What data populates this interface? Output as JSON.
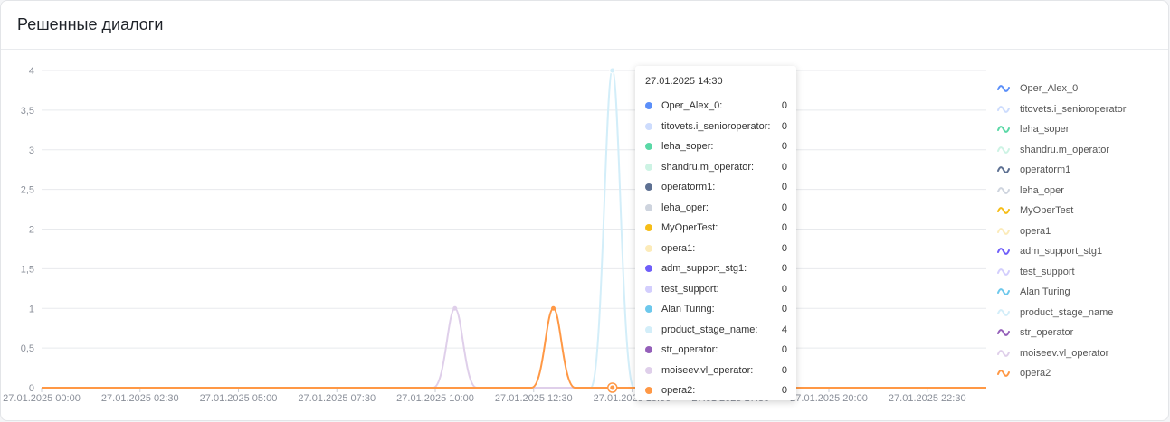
{
  "card": {
    "title": "Решенные диалоги"
  },
  "chart_data": {
    "type": "line",
    "title": "",
    "xlabel": "",
    "ylabel": "",
    "ylim": [
      0,
      4
    ],
    "y_ticks": [
      "0",
      "0,5",
      "1",
      "1,5",
      "2",
      "2,5",
      "3",
      "3,5",
      "4"
    ],
    "x_ticks": [
      "27.01.2025 00:00",
      "27.01.2025 02:30",
      "27.01.2025 05:00",
      "27.01.2025 07:30",
      "27.01.2025 10:00",
      "27.01.2025 12:30",
      "27.01.2025 15:00",
      "27.01.2025 17:30",
      "27.01.2025 20:00",
      "27.01.2025 22:30"
    ],
    "x_range_hours": [
      0,
      24
    ],
    "grid": true,
    "legend_position": "right",
    "series": [
      {
        "name": "Oper_Alex_0",
        "color": "#5b8ff9",
        "points": []
      },
      {
        "name": "titovets.i_senioroperator",
        "color": "#cddcfd",
        "points": []
      },
      {
        "name": "leha_soper",
        "color": "#5ad8a6",
        "points": []
      },
      {
        "name": "shandru.m_operator",
        "color": "#cdf3e4",
        "points": []
      },
      {
        "name": "operatorm1",
        "color": "#5d7092",
        "points": []
      },
      {
        "name": "leha_oper",
        "color": "#ced4de",
        "points": []
      },
      {
        "name": "MyOperTest",
        "color": "#f6bd16",
        "points": []
      },
      {
        "name": "opera1",
        "color": "#fcebb9",
        "points": []
      },
      {
        "name": "adm_support_stg1",
        "color": "#6f5ef9",
        "points": []
      },
      {
        "name": "test_support",
        "color": "#d3cefd",
        "points": []
      },
      {
        "name": "Alan Turing",
        "color": "#6dc8ec",
        "points": []
      },
      {
        "name": "product_stage_name",
        "color": "#d3eef9",
        "points": [
          {
            "x": 14.5,
            "y": 4
          }
        ]
      },
      {
        "name": "str_operator",
        "color": "#945fb9",
        "points": []
      },
      {
        "name": "moiseev.vl_operator",
        "color": "#dfcfea",
        "points": [
          {
            "x": 10.5,
            "y": 1
          }
        ]
      },
      {
        "name": "opera2",
        "color": "#ff9845",
        "points": [
          {
            "x": 13.0,
            "y": 1
          }
        ]
      }
    ]
  },
  "tooltip": {
    "title": "27.01.2025 14:30",
    "rows": [
      {
        "name": "Oper_Alex_0:",
        "value": "0",
        "color": "#5b8ff9"
      },
      {
        "name": "titovets.i_senioroperator:",
        "value": "0",
        "color": "#cddcfd"
      },
      {
        "name": "leha_soper:",
        "value": "0",
        "color": "#5ad8a6"
      },
      {
        "name": "shandru.m_operator:",
        "value": "0",
        "color": "#cdf3e4"
      },
      {
        "name": "operatorm1:",
        "value": "0",
        "color": "#5d7092"
      },
      {
        "name": "leha_oper:",
        "value": "0",
        "color": "#ced4de"
      },
      {
        "name": "MyOperTest:",
        "value": "0",
        "color": "#f6bd16"
      },
      {
        "name": "opera1:",
        "value": "0",
        "color": "#fcebb9"
      },
      {
        "name": "adm_support_stg1:",
        "value": "0",
        "color": "#6f5ef9"
      },
      {
        "name": "test_support:",
        "value": "0",
        "color": "#d3cefd"
      },
      {
        "name": "Alan Turing:",
        "value": "0",
        "color": "#6dc8ec"
      },
      {
        "name": "product_stage_name:",
        "value": "4",
        "color": "#d3eef9"
      },
      {
        "name": "str_operator:",
        "value": "0",
        "color": "#945fb9"
      },
      {
        "name": "moiseev.vl_operator:",
        "value": "0",
        "color": "#dfcfea"
      },
      {
        "name": "opera2:",
        "value": "0",
        "color": "#ff9845"
      }
    ]
  }
}
